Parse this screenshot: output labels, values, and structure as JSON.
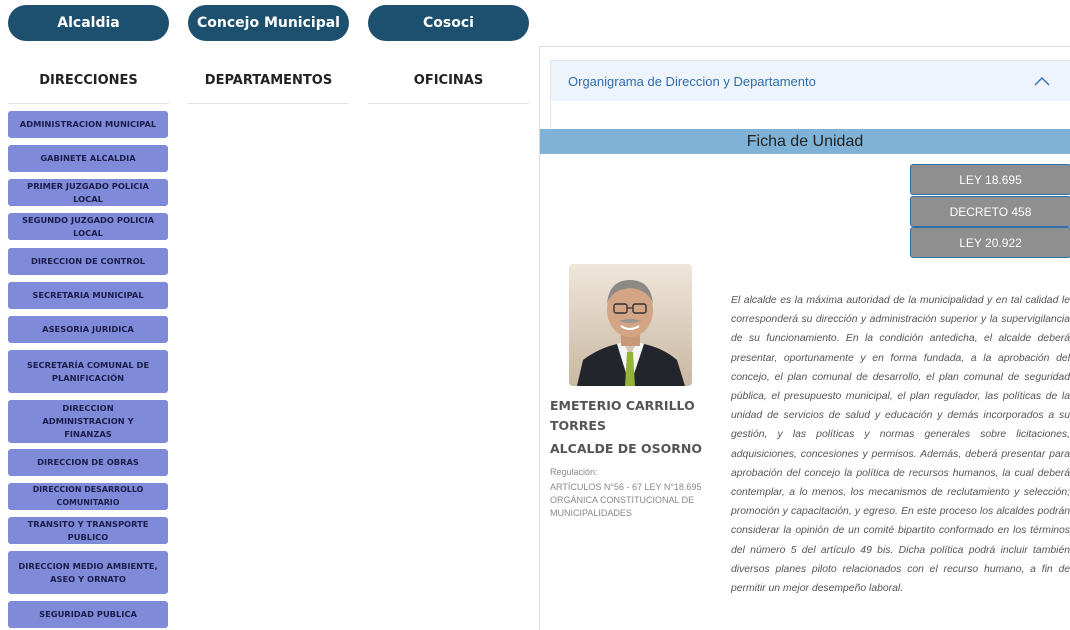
{
  "top_buttons": [
    "Alcaldia",
    "Concejo Municipal",
    "Cosoci"
  ],
  "columns": [
    "DIRECCIONES",
    "DEPARTAMENTOS",
    "OFICINAS"
  ],
  "direcciones": [
    "ADMINISTRACION MUNICIPAL",
    "GABINETE ALCALDIA",
    "PRIMER JUZGADO POLICIA LOCAL",
    "SEGUNDO JUZGADO POLICIA LOCAL",
    "DIRECCION DE CONTROL",
    "SECRETARIA MUNICIPAL",
    "ASESORIA JURIDICA",
    "SECRETARÍA COMUNAL DE PLANIFICACIÓN",
    "DIRECCION ADMINISTRACION Y FINANZAS",
    "DIRECCION DE OBRAS",
    "DIRECCION DESARROLLO COMUNITARIO",
    "TRANSITO Y TRANSPORTE PUBLICO",
    "DIRECCION MEDIO AMBIENTE, ASEO Y ORNATO",
    "SEGURIDAD PUBLICA"
  ],
  "accordion": {
    "title": "Organigrama de Direccion y Departamento"
  },
  "ficha": {
    "title": "Ficha de Unidad",
    "laws": [
      "LEY 18.695",
      "DECRETO 458",
      "LEY 20.922"
    ],
    "name": "EMETERIO CARRILLO TORRES",
    "role": "ALCALDE DE OSORNO",
    "reg_label": "Regulación:",
    "reg_text": "ARTÍCULOS N°56 - 67 LEY N°18.695 ORGÁNICA CONSTITUCIONAL DE MUNICIPALIDADES",
    "description": "El alcalde es la máxima autoridad de la municipalidad y en tal calidad le corresponderá su dirección y administración superior y la supervigilancia de su funcionamiento. En la condición antedicha, el alcalde deberá presentar, oportunamente y en forma fundada, a la aprobación del concejo, el plan comunal de desarrollo, el plan comunal de seguridad pública, el presupuesto municipal, el plan regulador, las políticas de la unidad de servicios de salud y educación y demás incorporados a su gestión, y las políticas y normas generales sobre licitaciones, adquisiciones, concesiones y permisos. Además, deberá presentar para aprobación del concejo la política de recursos humanos, la cual deberá contemplar, a lo menos, los mecanismos de reclutamiento y selección; promoción y capacitación, y egreso. En este proceso los alcaldes podrán considerar la opinión de un comité bipartito conformado en los términos del número 5 del artículo 49 bis. Dicha política podrá incluir también diversos planes piloto relacionados con el recurso humano, a fin de permitir un mejor desempeño laboral."
  },
  "icons": {
    "accordion_toggle": "chevron-up-icon",
    "photo": "person-photo"
  },
  "colors": {
    "pill": "#1d4f6e",
    "dir_button": "#7f8bd8",
    "ficha_bar": "#7fb2d6",
    "law_button": "#8f8f8f",
    "link": "#2f6db0"
  }
}
